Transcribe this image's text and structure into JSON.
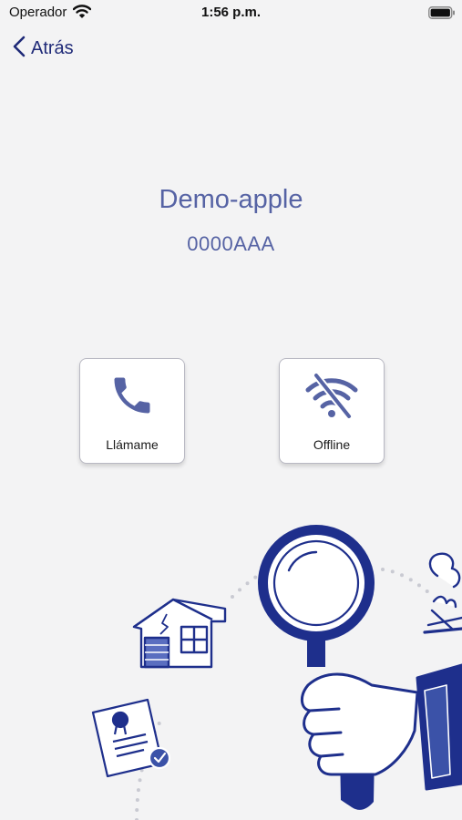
{
  "status_bar": {
    "carrier": "Operador",
    "time": "1:56 p.m."
  },
  "nav": {
    "back_label": "Atrás"
  },
  "device": {
    "name": "Demo-apple",
    "code": "0000AAA"
  },
  "actions": [
    {
      "label": "Llámame",
      "icon": "phone-icon"
    },
    {
      "label": "Offline",
      "icon": "wifi-off-icon"
    }
  ],
  "colors": {
    "primary": "#5663a4",
    "nav": "#1f2a78",
    "illustration": "#1e2f8c",
    "background": "#f3f3f4"
  }
}
